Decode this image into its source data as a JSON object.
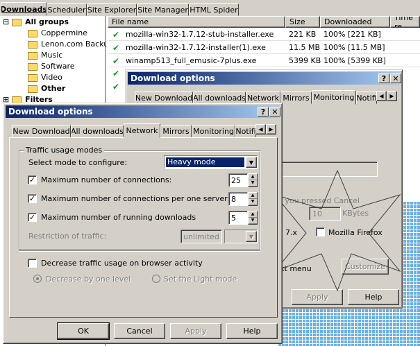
{
  "main_tabs": [
    "Downloads",
    "Scheduler",
    "Site Explorer",
    "Site Manager",
    "HTML Spider"
  ],
  "tree": {
    "all_groups": "All groups",
    "children": [
      "Coppermine",
      "Lenon.com Backup",
      "Music",
      "Software",
      "Video",
      "Other"
    ],
    "filters": "Filters"
  },
  "columns": [
    "File name",
    "Size",
    "Downloaded",
    "Time re..."
  ],
  "rows": [
    {
      "name": "mozilla-win32-1.7.12-stub-installer.exe",
      "size": "221 KB",
      "downloaded": "100% [221 KB]"
    },
    {
      "name": "mozilla-win32-1.7.12-installer(1).exe",
      "size": "11.5 MB",
      "downloaded": "100% [11.5 MB]"
    },
    {
      "name": "winamp513_full_emusic-7plus.exe",
      "size": "5399 KB",
      "downloaded": "100% [5399 KB]"
    }
  ],
  "back_dialog": {
    "title": "Download options",
    "tabs": [
      "New Download",
      "All downloads",
      "Network",
      "Mirrors",
      "Monitoring",
      "Notifi"
    ],
    "partial_text": "f you pressed Cancel",
    "kbytes_value": "10",
    "kbytes_label": "KBytes",
    "version": "7.x",
    "firefox_label": "Mozilla Firefox",
    "context_menu": "xt menu",
    "customize": "Customize",
    "apply": "Apply",
    "help": "Help"
  },
  "dialog": {
    "title": "Download options",
    "help_btn": "?",
    "close_btn": "✕",
    "tabs": [
      "New Download",
      "All downloads",
      "Network",
      "Mirrors",
      "Monitoring",
      "Notifi"
    ],
    "group_label": "Traffic usage modes",
    "mode_label": "Select mode to configure:",
    "mode_value": "Heavy mode",
    "max_connections_label": "Maximum number of connections:",
    "max_connections": "25",
    "max_per_server_label": "Maximum number of connections per one server:",
    "max_per_server": "8",
    "max_running_label": "Maximum number of running downloads",
    "max_running": "5",
    "restriction_label": "Restriction of traffic:",
    "restriction_value": "unlimited",
    "decrease_label": "Decrease traffic usage on browser activity",
    "radio1": "Decrease by one level",
    "radio2": "Set the Light mode",
    "ok": "OK",
    "cancel": "Cancel",
    "apply": "Apply",
    "help": "Help"
  }
}
